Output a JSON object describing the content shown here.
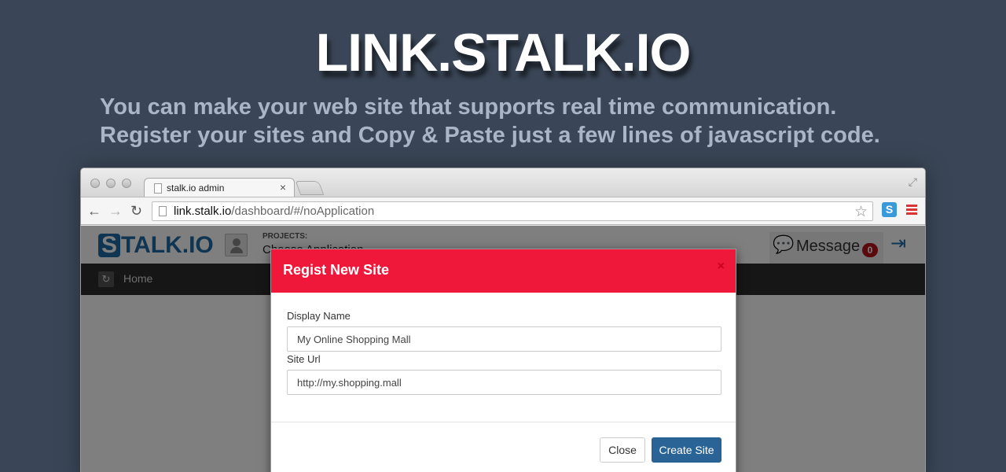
{
  "hero": {
    "title": "LINK.STALK.IO",
    "subtitle_line1": "You can make your web site that supports real time communication.",
    "subtitle_line2": "Register your sites and Copy & Paste just a few lines of javascript code."
  },
  "browser": {
    "tab_title": "stalk.io admin",
    "url_host": "link.stalk.io",
    "url_path": "/dashboard/#/noApplication",
    "extension_label": "S"
  },
  "app": {
    "logo_letter": "S",
    "logo_text": "TALK.IO",
    "projects_label": "PROJECTS:",
    "projects_value": "Choose Application ...",
    "message_label": "Message",
    "message_count": "0",
    "nav_home": "Home"
  },
  "modal": {
    "title": "Regist New Site",
    "close_x": "×",
    "display_name_label": "Display Name",
    "display_name_value": "My Online Shopping Mall",
    "site_url_label": "Site Url",
    "site_url_value": "http://my.shopping.mall",
    "close_button": "Close",
    "create_button": "Create Site"
  },
  "colors": {
    "background": "#3a4657",
    "modal_header": "#f0183a",
    "primary_button": "#2a6496",
    "badge": "#b5121b"
  }
}
